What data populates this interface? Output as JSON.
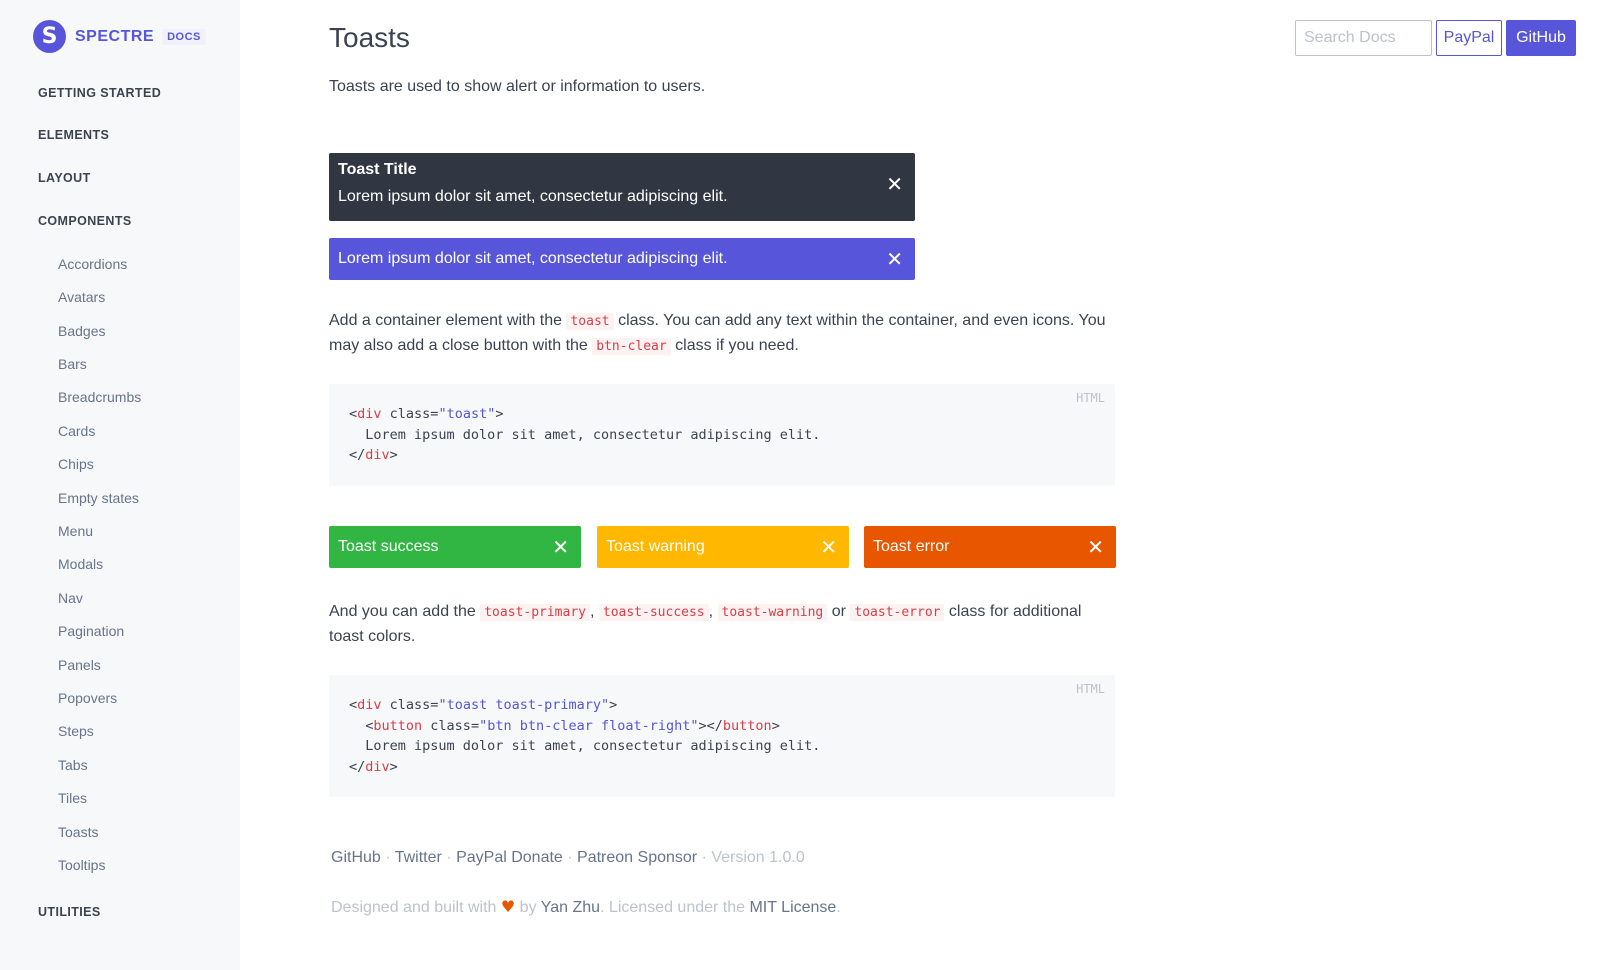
{
  "brand": {
    "logo_letter": "S",
    "name": "SPECTRE",
    "badge": "DOCS"
  },
  "sidebar": {
    "sections": {
      "getting_started": "GETTING STARTED",
      "elements": "ELEMENTS",
      "layout": "LAYOUT",
      "components": "COMPONENTS",
      "utilities": "UTILITIES"
    },
    "components": [
      "Accordions",
      "Avatars",
      "Badges",
      "Bars",
      "Breadcrumbs",
      "Cards",
      "Chips",
      "Empty states",
      "Menu",
      "Modals",
      "Nav",
      "Pagination",
      "Panels",
      "Popovers",
      "Steps",
      "Tabs",
      "Tiles",
      "Toasts",
      "Tooltips"
    ]
  },
  "header": {
    "search_placeholder": "Search Docs",
    "paypal_label": "PayPal",
    "github_label": "GitHub"
  },
  "main": {
    "title": "Toasts",
    "lead": "Toasts are used to show alert or information to users.",
    "toast_dark": {
      "title": "Toast Title",
      "body": "Lorem ipsum dolor sit amet, consectetur adipiscing elit."
    },
    "toast_primary": "Lorem ipsum dolor sit amet, consectetur adipiscing elit.",
    "close_glyph": "✕",
    "para1": {
      "a": "Add a container element with the ",
      "code1": "toast",
      "b": " class. You can add any text within the container, and even icons. You may also add a close button with the ",
      "code2": "btn-clear",
      "c": " class if you need."
    },
    "code_lang": "HTML",
    "code1": {
      "l1a": "<",
      "l1tag": "div",
      "l1b": " class=",
      "l1str": "\"toast\"",
      "l1c": ">",
      "l2": "  Lorem ipsum dolor sit amet, consectetur adipiscing elit.",
      "l3a": "</",
      "l3tag": "div",
      "l3c": ">"
    },
    "toast_success": "Toast success",
    "toast_warning": "Toast warning",
    "toast_error": "Toast error",
    "para2": {
      "a": "And you can add the ",
      "c1": "toast-primary",
      "s1": ", ",
      "c2": "toast-success",
      "s2": ", ",
      "c3": "toast-warning",
      "s3": " or ",
      "c4": "toast-error",
      "b": " class for additional toast colors."
    },
    "code2": {
      "l1a": "<",
      "l1tag": "div",
      "l1b": " class=",
      "l1str": "\"toast toast-primary\"",
      "l1c": ">",
      "l2a": "  <",
      "l2tag": "button",
      "l2b": " class=",
      "l2str": "\"btn btn-clear float-right\"",
      "l2c": "></",
      "l2tag2": "button",
      "l2d": ">",
      "l3": "  Lorem ipsum dolor sit amet, consectetur adipiscing elit.",
      "l4a": "</",
      "l4tag": "div",
      "l4c": ">"
    }
  },
  "footer": {
    "links": [
      "GitHub",
      "Twitter",
      "PayPal Donate",
      "Patreon Sponsor"
    ],
    "sep": " · ",
    "version": "Version 1.0.0",
    "credit_a": "Designed and built with ",
    "heart": "♥",
    "credit_b": " by ",
    "author": "Yan Zhu",
    "credit_c": ". Licensed under the ",
    "license": "MIT License",
    "credit_d": "."
  },
  "colors": {
    "primary": "#5755d9",
    "dark": "#303742",
    "success": "#32b643",
    "warning": "#ffb700",
    "error": "#e85600",
    "code_red": "#d73e48"
  }
}
